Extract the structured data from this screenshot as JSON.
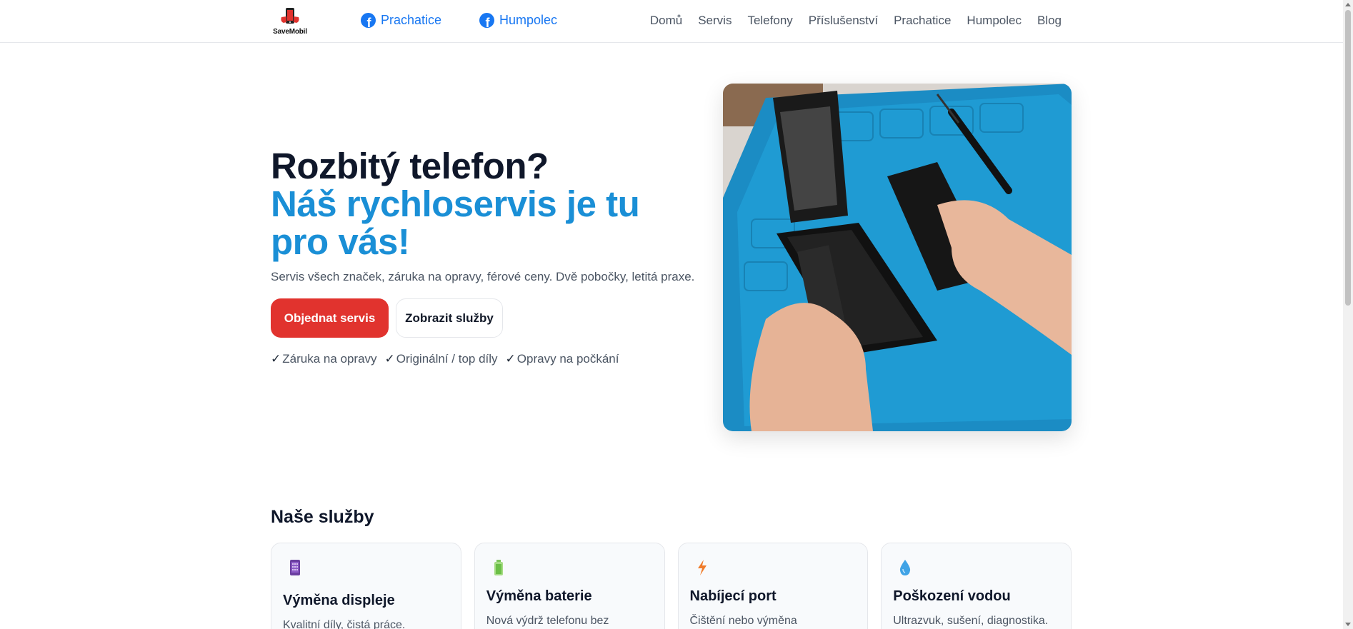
{
  "header": {
    "logo_text": "SaveMobil",
    "facebook_links": [
      "Prachatice",
      "Humpolec"
    ],
    "nav": [
      "Domů",
      "Servis",
      "Telefony",
      "Příslušenství",
      "Prachatice",
      "Humpolec",
      "Blog"
    ]
  },
  "hero": {
    "title_line1": "Rozbitý telefon?",
    "title_line2": "Náš rychloservis je tu pro vás!",
    "subtitle": "Servis všech značek, záruka na opravy, férové ceny. Dvě pobočky, letitá praxe.",
    "primary_button": "Objednat servis",
    "secondary_button": "Zobrazit služby",
    "features": [
      "Záruka na opravy",
      "Originální / top díly",
      "Opravy na počkání"
    ],
    "check_glyph": "✓"
  },
  "services": {
    "title": "Naše služby",
    "cards": [
      {
        "icon": "phone-display-icon",
        "title": "Výměna displeje",
        "desc": "Kvalitní díly, čistá práce."
      },
      {
        "icon": "battery-icon",
        "title": "Výměna baterie",
        "desc": "Nová výdrž telefonu bez"
      },
      {
        "icon": "lightning-icon",
        "title": "Nabíjecí port",
        "desc": "Čištění nebo výměna"
      },
      {
        "icon": "water-drop-icon",
        "title": "Poškození vodou",
        "desc": "Ultrazvuk, sušení, diagnostika."
      }
    ]
  },
  "colors": {
    "brand_blue": "#1a8fd6",
    "primary_red": "#e1332e",
    "facebook_blue": "#1877f2"
  }
}
